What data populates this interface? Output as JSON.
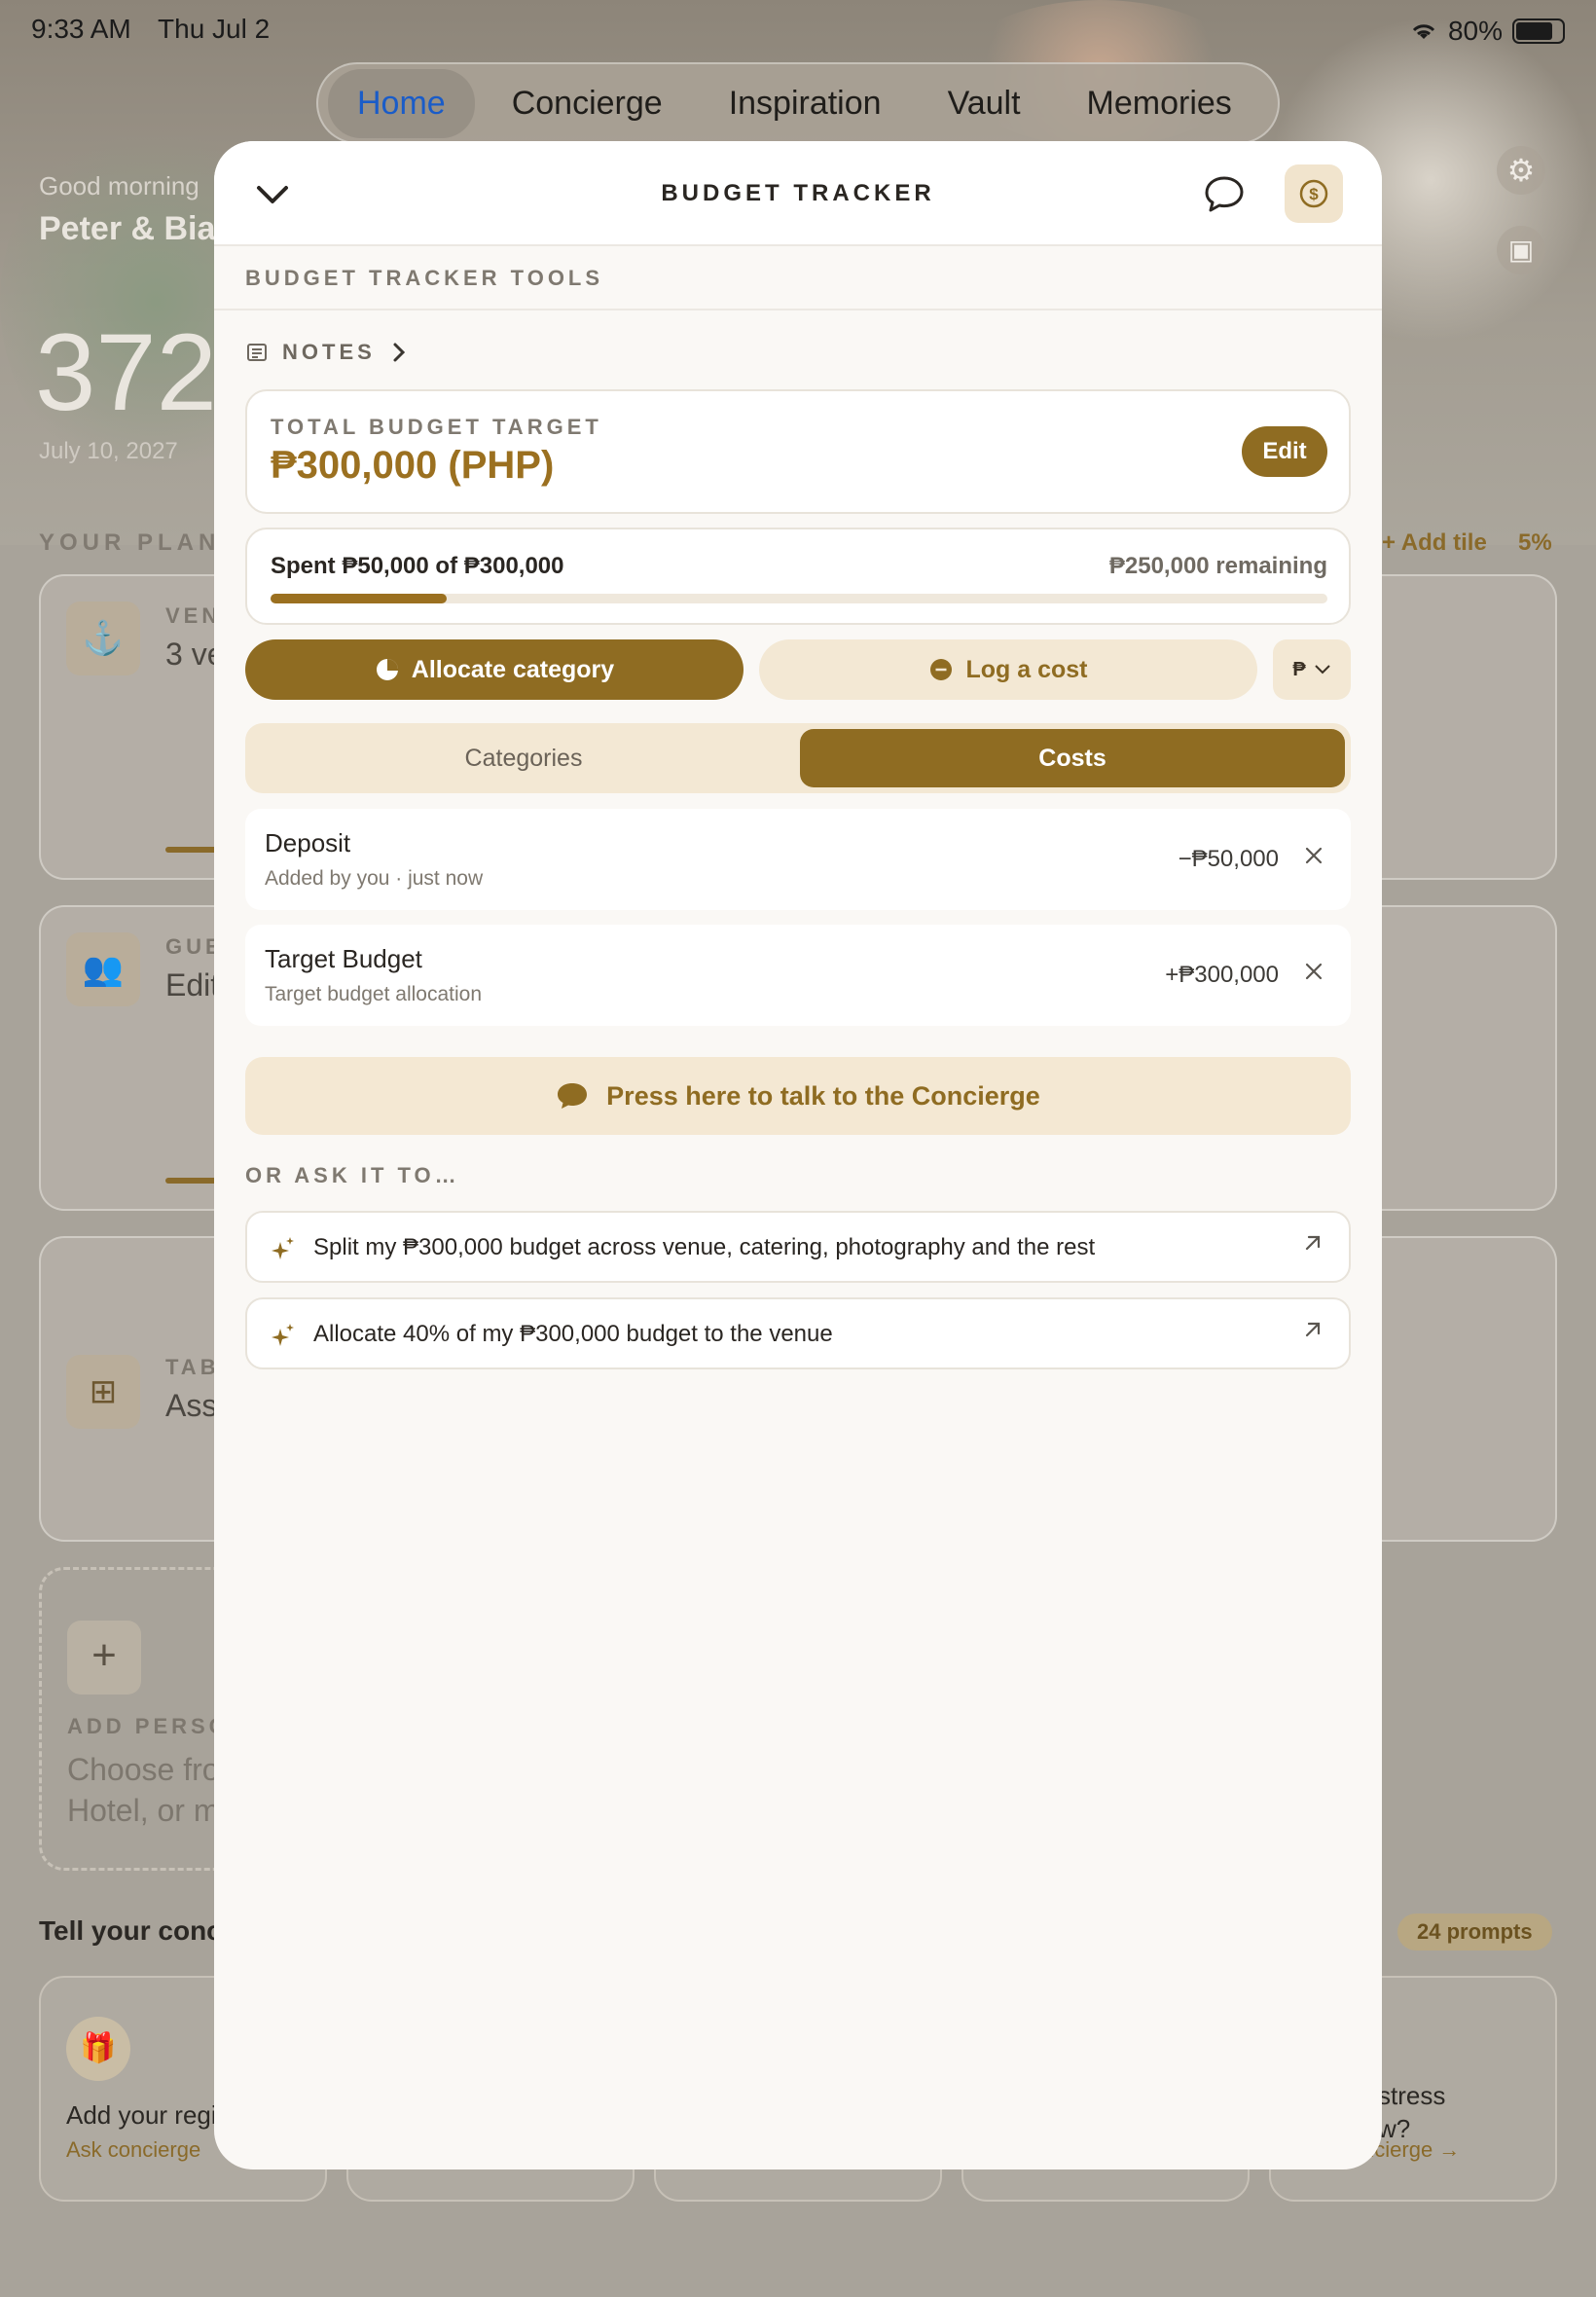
{
  "status": {
    "time": "9:33 AM",
    "day": "Thu Jul 2",
    "battery": "80%"
  },
  "topnav": {
    "tabs": [
      "Home",
      "Concierge",
      "Inspiration",
      "Vault",
      "Memories"
    ]
  },
  "home": {
    "greeting": "Good morning",
    "couple": "Peter & Biar",
    "countdown": "372",
    "date": "July 10, 2027",
    "your_plan": "YOUR PLAN",
    "add_tile": "+ Add tile",
    "percent": "5%",
    "cards": [
      {
        "label": "VEN",
        "value": "3 ve"
      },
      {
        "label": "GUE",
        "value": "Edit"
      },
      {
        "label": "TAB",
        "value": "Ass"
      }
    ],
    "add_person": {
      "title": "ADD PERSO",
      "line1": "Choose fro",
      "line2": "Hotel, or m"
    },
    "tell": "Tell your conci",
    "prompts_badge": "24 prompts",
    "prompt_cards": [
      {
        "title": "Add your regi",
        "link": "Ask concierge"
      },
      {
        "title": "stress\nw?",
        "link": "Ask concierge →"
      }
    ]
  },
  "modal": {
    "title": "BUDGET TRACKER",
    "tools_heading": "BUDGET TRACKER TOOLS",
    "notes_label": "NOTES",
    "total_label": "TOTAL BUDGET TARGET",
    "total_amount": "₱300,000 (PHP)",
    "edit_label": "Edit",
    "spent_text": "Spent ₱50,000 of ₱300,000",
    "remaining_text": "₱250,000 remaining",
    "spent_fraction": 0.1667,
    "allocate_label": "Allocate category",
    "log_label": "Log a cost",
    "currency_symbol": "₱",
    "tabs": {
      "categories": "Categories",
      "costs": "Costs"
    },
    "costs": [
      {
        "name": "Deposit",
        "sub": "Added by you · just now",
        "amount": "−₱50,000"
      },
      {
        "name": "Target Budget",
        "sub": "Target budget allocation",
        "amount": "+₱300,000"
      }
    ],
    "talk_label": "Press here to talk to the Concierge",
    "or_ask": "OR ASK IT TO…",
    "suggestions": [
      "Split my ₱300,000 budget across venue, catering, photography and the rest",
      "Allocate 40% of my ₱300,000 budget to the venue"
    ]
  },
  "colors": {
    "accent": "#8f6c22",
    "accent_light": "#f3e8d4",
    "nav_active": "#1a5cc8"
  },
  "icons": [
    "chevron-down-icon",
    "chat-bubble-icon",
    "dollar-icon",
    "notes-icon",
    "chevron-right-icon",
    "pie-chart-icon",
    "minus-circle-icon",
    "close-icon",
    "sparkle-icon",
    "arrow-up-right-icon",
    "gear-icon",
    "add-image-icon",
    "gift-icon"
  ]
}
